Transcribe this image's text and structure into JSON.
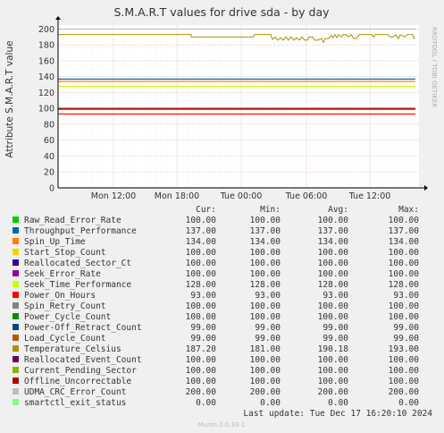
{
  "chart_data": {
    "type": "line",
    "title": "S.M.A.R.T values for drive sda - by day",
    "ylabel": "Attribute S.M.A.R.T value",
    "ylim": [
      0,
      205
    ],
    "y_ticks": [
      0,
      20,
      40,
      60,
      80,
      100,
      120,
      140,
      160,
      180,
      200
    ],
    "x_tick_labels": [
      "Mon 12:00",
      "Mon 18:00",
      "Tue 00:00",
      "Tue 06:00",
      "Tue 12:00"
    ],
    "grid": true,
    "side_label": "RRDTOOL / TOBI OETIKER",
    "columns": {
      "cur": "Cur:",
      "min": "Min:",
      "avg": "Avg:",
      "max": "Max:"
    },
    "series": [
      {
        "name": "Raw_Read_Error_Rate",
        "color": "#00cc00",
        "cur": "100.00",
        "min": "100.00",
        "avg": "100.00",
        "max": "100.00",
        "value": 100
      },
      {
        "name": "Throughput_Performance",
        "color": "#0066b3",
        "cur": "137.00",
        "min": "137.00",
        "avg": "137.00",
        "max": "137.00",
        "value": 137
      },
      {
        "name": "Spin_Up_Time",
        "color": "#ff8000",
        "cur": "134.00",
        "min": "134.00",
        "avg": "134.00",
        "max": "134.00",
        "value": 134
      },
      {
        "name": "Start_Stop_Count",
        "color": "#ffcc00",
        "cur": "100.00",
        "min": "100.00",
        "avg": "100.00",
        "max": "100.00",
        "value": 100
      },
      {
        "name": "Reallocated_Sector_Ct",
        "color": "#330099",
        "cur": "100.00",
        "min": "100.00",
        "avg": "100.00",
        "max": "100.00",
        "value": 100
      },
      {
        "name": "Seek_Error_Rate",
        "color": "#990099",
        "cur": "100.00",
        "min": "100.00",
        "avg": "100.00",
        "max": "100.00",
        "value": 100
      },
      {
        "name": "Seek_Time_Performance",
        "color": "#ccff00",
        "cur": "128.00",
        "min": "128.00",
        "avg": "128.00",
        "max": "128.00",
        "value": 128
      },
      {
        "name": "Power_On_Hours",
        "color": "#ff0000",
        "cur": "93.00",
        "min": "93.00",
        "avg": "93.00",
        "max": "93.00",
        "value": 93
      },
      {
        "name": "Spin_Retry_Count",
        "color": "#808080",
        "cur": "100.00",
        "min": "100.00",
        "avg": "100.00",
        "max": "100.00",
        "value": 100
      },
      {
        "name": "Power_Cycle_Count",
        "color": "#008f00",
        "cur": "100.00",
        "min": "100.00",
        "avg": "100.00",
        "max": "100.00",
        "value": 100
      },
      {
        "name": "Power-Off_Retract_Count",
        "color": "#00487d",
        "cur": "99.00",
        "min": "99.00",
        "avg": "99.00",
        "max": "99.00",
        "value": 99
      },
      {
        "name": "Load_Cycle_Count",
        "color": "#b35a00",
        "cur": "99.00",
        "min": "99.00",
        "avg": "99.00",
        "max": "99.00",
        "value": 99
      },
      {
        "name": "Temperature_Celsius",
        "color": "#b38f00",
        "cur": "187.20",
        "min": "181.00",
        "avg": "190.18",
        "max": "193.00",
        "value": 190
      },
      {
        "name": "Reallocated_Event_Count",
        "color": "#6b006b",
        "cur": "100.00",
        "min": "100.00",
        "avg": "100.00",
        "max": "100.00",
        "value": 100
      },
      {
        "name": "Current_Pending_Sector",
        "color": "#8fb300",
        "cur": "100.00",
        "min": "100.00",
        "avg": "100.00",
        "max": "100.00",
        "value": 100
      },
      {
        "name": "Offline_Uncorrectable",
        "color": "#b30000",
        "cur": "100.00",
        "min": "100.00",
        "avg": "100.00",
        "max": "100.00",
        "value": 100
      },
      {
        "name": "UDMA_CRC_Error_Count",
        "color": "#bebebe",
        "cur": "200.00",
        "min": "200.00",
        "avg": "200.00",
        "max": "200.00",
        "value": 200
      },
      {
        "name": "smartctl_exit_status",
        "color": "#80ff80",
        "cur": "0.00",
        "min": "0.00",
        "avg": "0.00",
        "max": "0.00",
        "value": 0
      }
    ],
    "last_update": "Last update:  Tue Dec 17 16:20:10 2024",
    "footer": "Munin 2.0.33-1"
  }
}
